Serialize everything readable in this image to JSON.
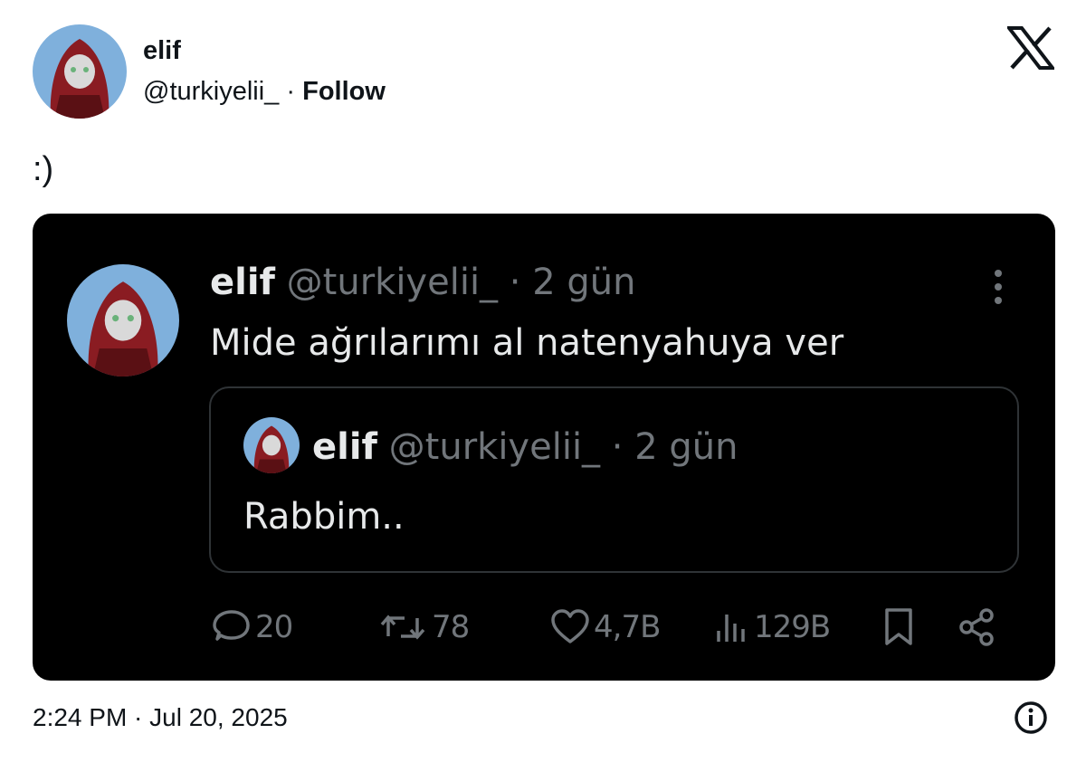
{
  "author": {
    "name": "elif",
    "handle": "@turkiyelii_",
    "separator": "·",
    "follow_label": "Follow"
  },
  "tweet": {
    "text": ":)",
    "timestamp": "2:24 PM · Jul 20, 2025"
  },
  "embedded": {
    "name": "elif",
    "handle_time": "@turkiyelii_ · 2 gün",
    "text": "Mide ağrılarımı al natenyahuya ver",
    "quoted": {
      "name": "elif",
      "handle_time": "@turkiyelii_ · 2 gün",
      "text": "Rabbim.."
    },
    "actions": {
      "replies": "20",
      "reposts": "78",
      "likes": "4,7B",
      "views": "129B"
    }
  },
  "icons": {
    "logo": "x-logo-icon",
    "more": "more-vertical-icon",
    "reply": "reply-icon",
    "repost": "repost-icon",
    "like": "heart-icon",
    "views": "views-icon",
    "bookmark": "bookmark-icon",
    "share": "share-icon",
    "info": "info-icon"
  },
  "colors": {
    "card_bg": "#000000",
    "text_dark": "#e7e9ea",
    "muted": "#71767b",
    "border": "#2f3336"
  }
}
